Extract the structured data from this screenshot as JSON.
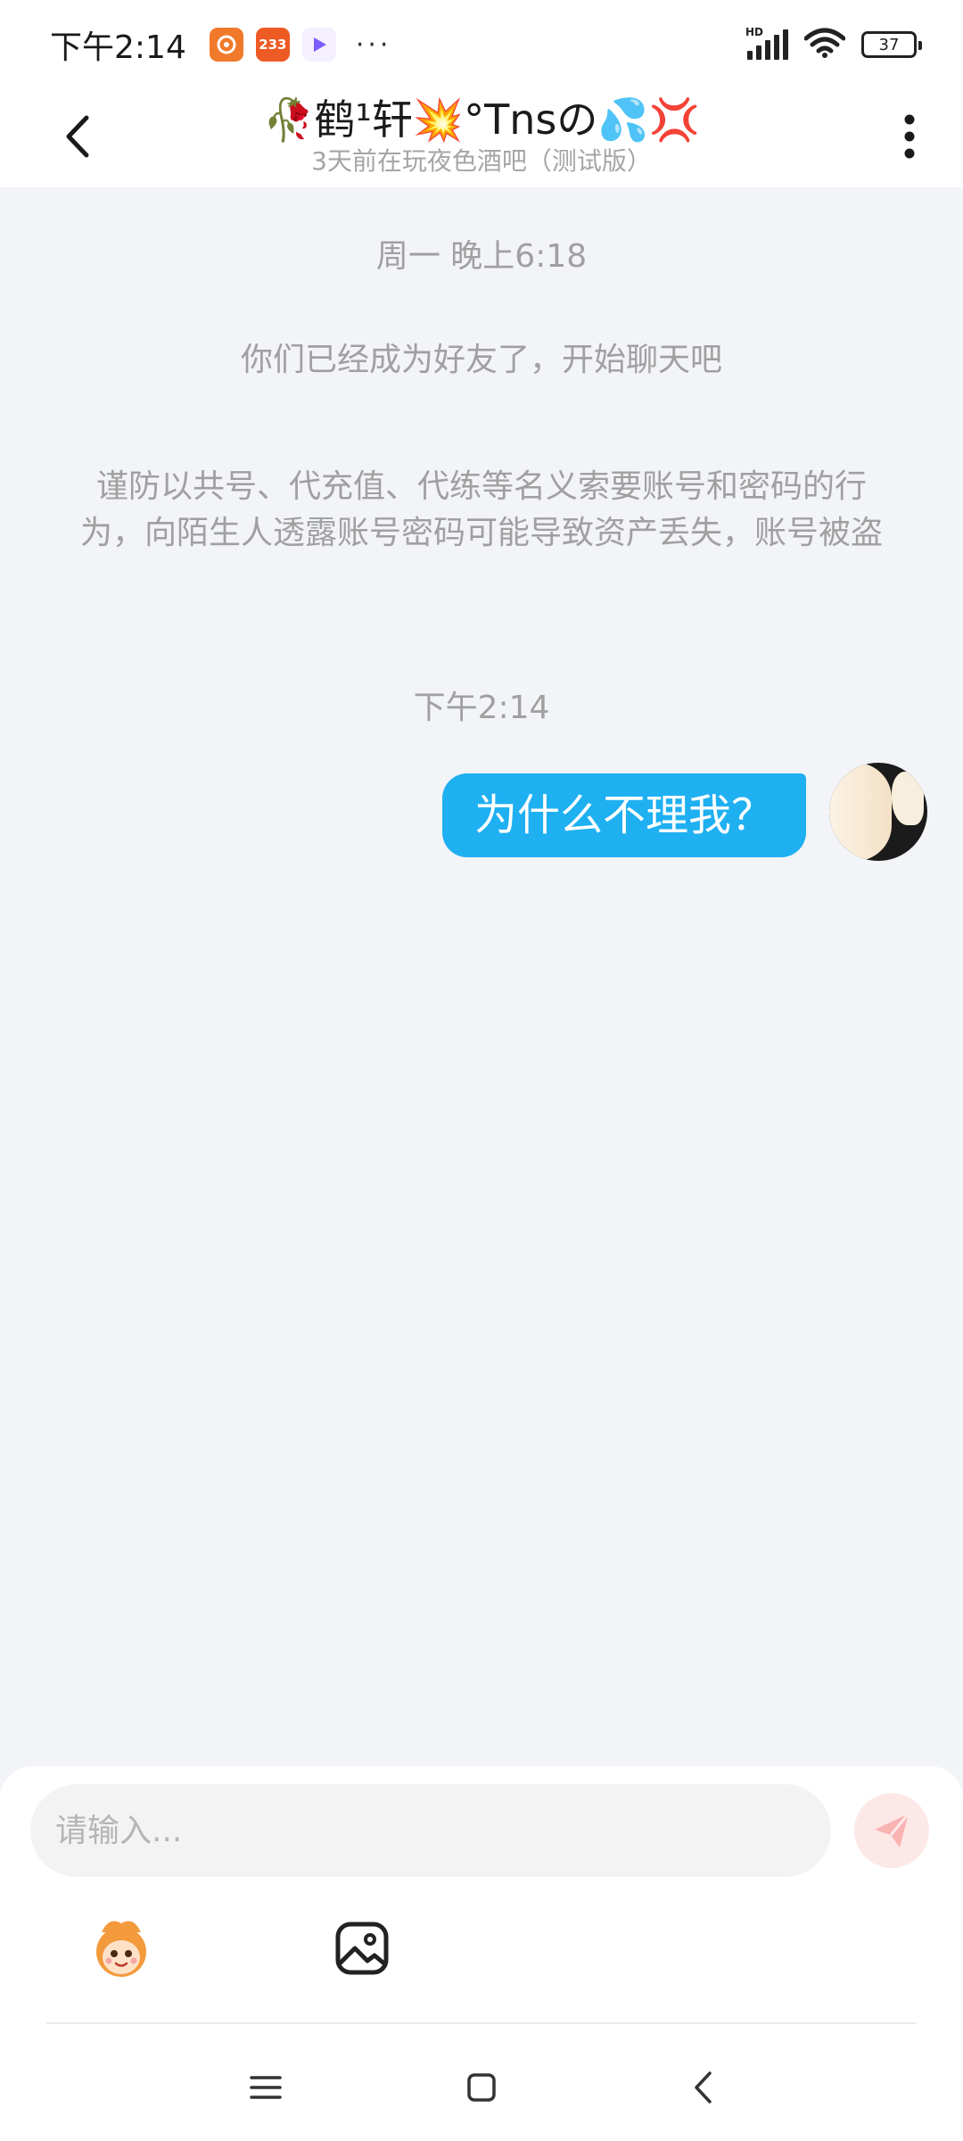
{
  "status_bar": {
    "time": "下午2:14",
    "notification_apps": [
      "app-orange",
      "233",
      "video-app"
    ],
    "more": "···",
    "network_badge": "HD",
    "battery_level": "37"
  },
  "header": {
    "title": "🥀鹤¹轩💥°Tnsの💦💢",
    "subtitle": "3天前在玩夜色酒吧（测试版）"
  },
  "chat": {
    "timestamp_1": "周一 晚上6:18",
    "friend_notice": "你们已经成为好友了，开始聊天吧",
    "security_notice": "谨防以共号、代充值、代练等名义索要账号和密码的行为，向陌生人透露账号密码可能导致资产丢失，账号被盗",
    "timestamp_2": "下午2:14",
    "messages": [
      {
        "sender": "me",
        "text": "为什么不理我？"
      }
    ]
  },
  "composer": {
    "placeholder": "请输入...",
    "value": ""
  },
  "colors": {
    "accent_bubble": "#1fb0f2",
    "send_button_bg": "#fde8e8",
    "send_icon": "#f9b3b3",
    "background": "#f2f4f8"
  },
  "icons": {
    "back": "chevron-left-icon",
    "more": "vertical-ellipsis-icon",
    "send": "paper-plane-icon",
    "sticker": "mascot-sticker-icon",
    "image": "image-icon",
    "nav_menu": "menu-icon",
    "nav_home": "square-home-icon",
    "nav_back": "chevron-back-icon"
  }
}
